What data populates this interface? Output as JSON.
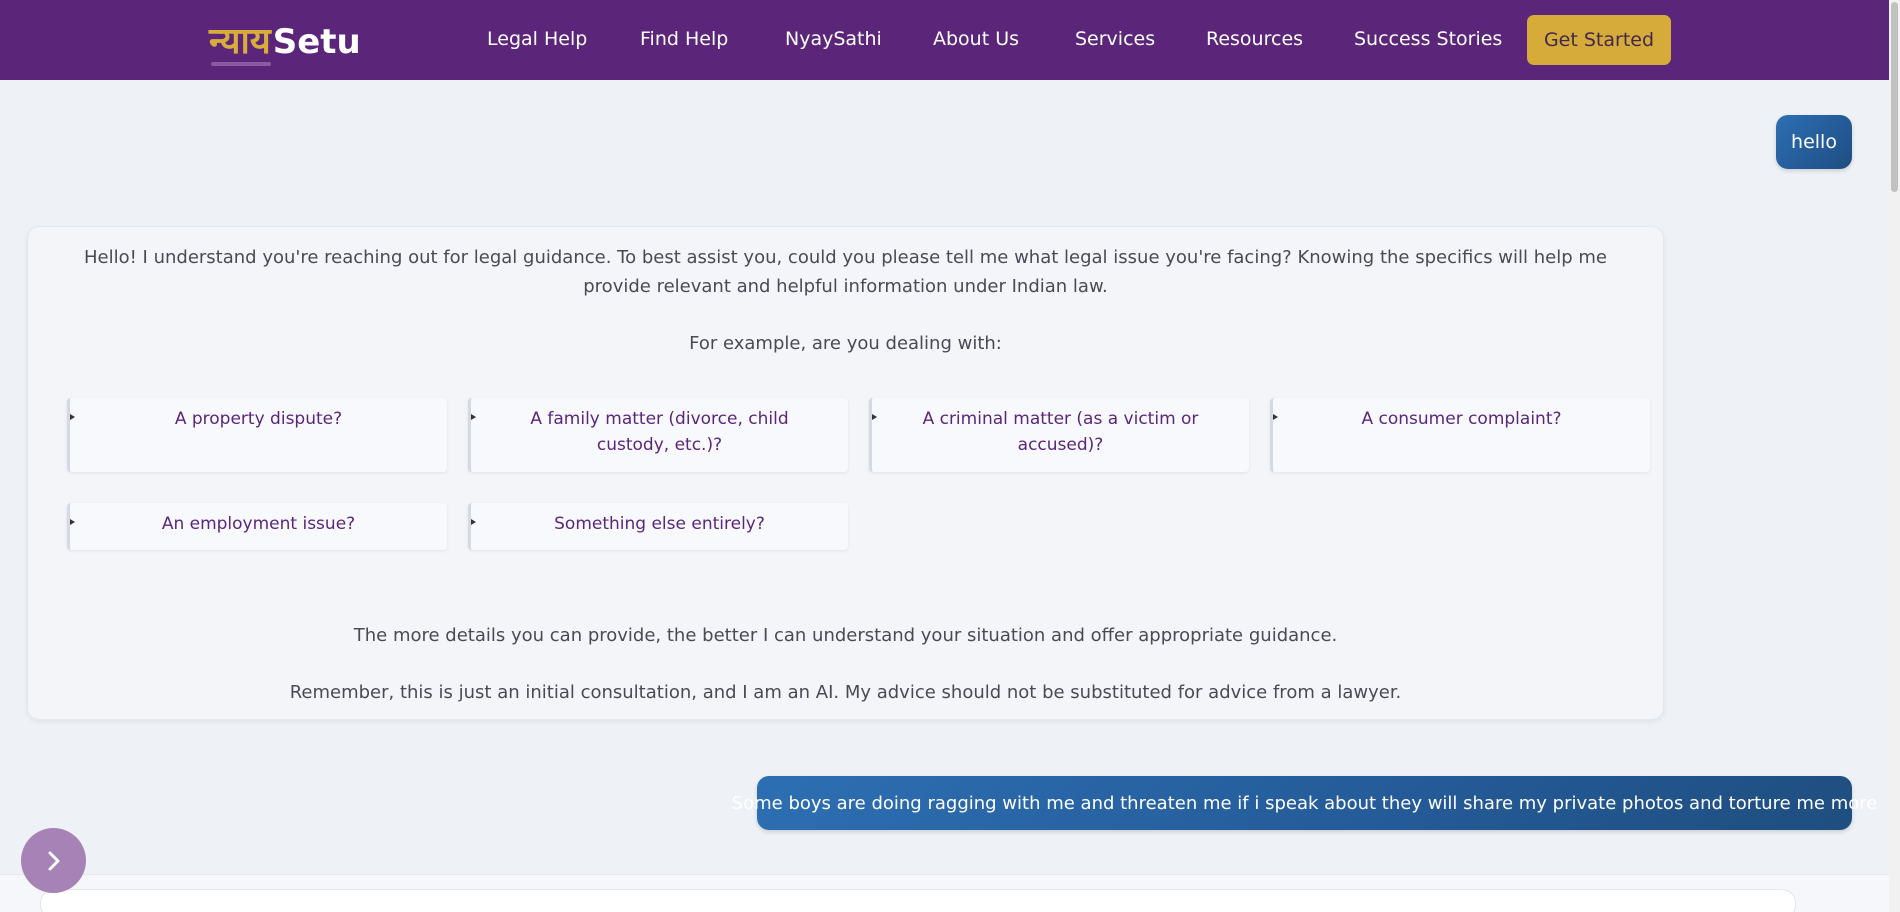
{
  "header": {
    "logo_hindi": "न्याय",
    "logo_en": "Setu",
    "nav": [
      "Legal Help",
      "Find Help",
      "NyaySathi",
      "About Us",
      "Services",
      "Resources",
      "Success Stories"
    ],
    "cta": "Get Started"
  },
  "chat": {
    "user_message_1": "hello",
    "bot": {
      "intro": "Hello! I understand you're reaching out for legal guidance. To best assist you, could you please tell me what legal issue you're facing? Knowing the specifics will help me provide relevant and helpful information under Indian law.",
      "example_prompt": "For example, are you dealing with:",
      "options": [
        "A property dispute?",
        "A family matter (divorce, child custody, etc.)?",
        "A criminal matter (as a victim or accused)?",
        "A consumer complaint?",
        "An employment issue?",
        "Something else entirely?"
      ],
      "more_details": "The more details you can provide, the better I can understand your situation and offer appropriate guidance.",
      "disclaimer": "Remember, this is just an initial consultation, and I am an AI. My advice should not be substituted for advice from a lawyer."
    },
    "user_message_2": "Some boys are doing ragging with me and threaten me if i speak about they will share my private photos and torture me more"
  },
  "icons": {
    "toggle": "chevron-right-icon",
    "option_marker": "triangle-right-icon"
  },
  "colors": {
    "header_bg": "#5b2679",
    "logo_gold": "#d9ad3b",
    "cta_bg": "#d6ab3a",
    "user_bubble": "#2a65a6",
    "option_text": "#5b2679",
    "toggle_bg": "#a782b6"
  }
}
